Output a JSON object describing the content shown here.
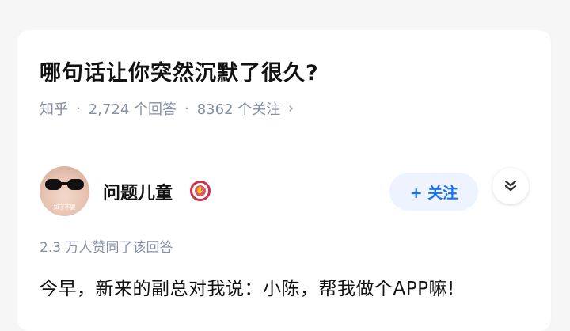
{
  "question": {
    "title": "哪句话让你突然沉默了很久?",
    "source": "知乎",
    "separator": "·",
    "answers": "2,724 个回答",
    "followers": "8362 个关注",
    "chevron": "›"
  },
  "author": {
    "name": "问题儿童",
    "avatar_caption": "知了不要",
    "follow_label": "+ 关注"
  },
  "answer": {
    "votes": "2.3 万人赞同了该回答",
    "text": "今早，新来的副总对我说：小陈，帮我做个APP嘛!"
  },
  "icons": {
    "expand": "double-chevron-down-icon",
    "badge": "author-badge-icon"
  },
  "colors": {
    "accent": "#1772f6",
    "meta": "#8590a6",
    "badge": "#c8344a"
  }
}
